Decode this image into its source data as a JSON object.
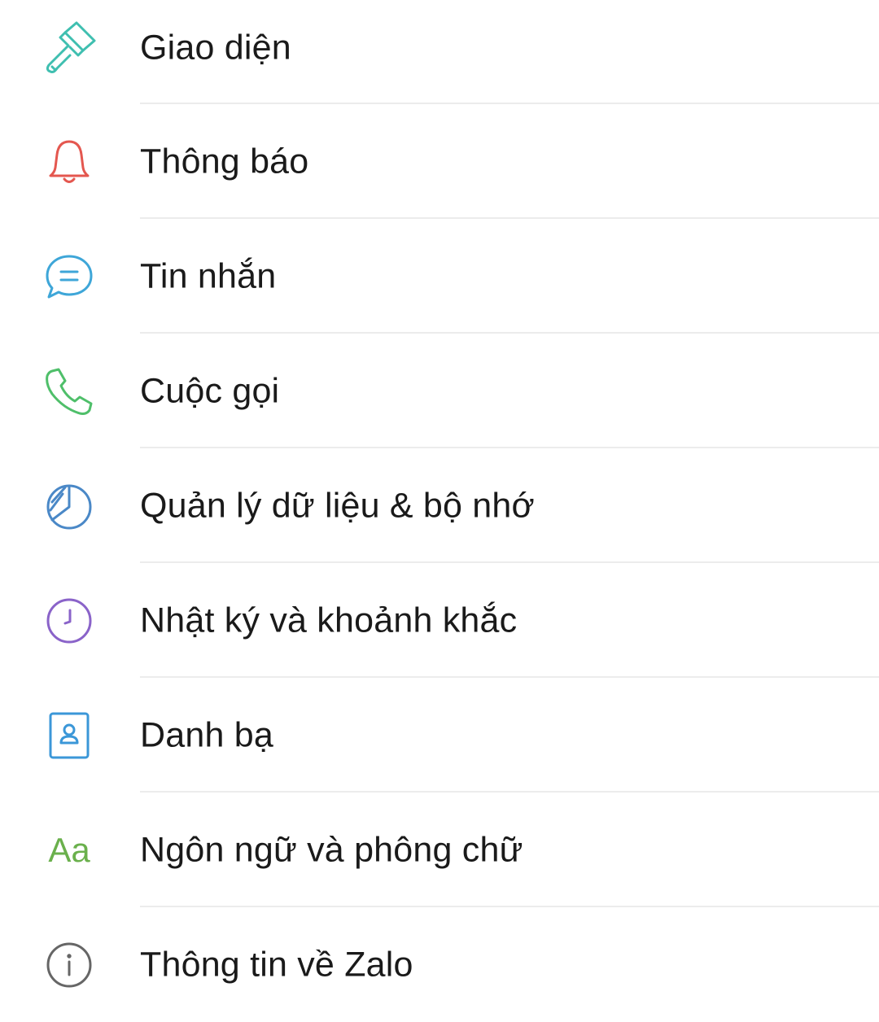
{
  "settings": {
    "items": [
      {
        "label": "Giao diện",
        "icon": "paint-roller-icon",
        "color": "#3fbfb0"
      },
      {
        "label": "Thông báo",
        "icon": "bell-icon",
        "color": "#e4574f"
      },
      {
        "label": "Tin nhắn",
        "icon": "chat-bubble-icon",
        "color": "#3ea6d8"
      },
      {
        "label": "Cuộc gọi",
        "icon": "phone-icon",
        "color": "#4fbf6a"
      },
      {
        "label": "Quản lý dữ liệu & bộ nhớ",
        "icon": "pie-chart-icon",
        "color": "#4a88c7"
      },
      {
        "label": "Nhật ký và khoảnh khắc",
        "icon": "clock-icon",
        "color": "#8a63c9"
      },
      {
        "label": "Danh bạ",
        "icon": "contact-card-icon",
        "color": "#3b97d8"
      },
      {
        "label": "Ngôn ngữ và phông chữ",
        "icon": "font-aa-icon",
        "color": "#6ab04c",
        "glyph": "Aa"
      },
      {
        "label": "Thông tin về Zalo",
        "icon": "info-icon",
        "color": "#666666"
      }
    ]
  }
}
